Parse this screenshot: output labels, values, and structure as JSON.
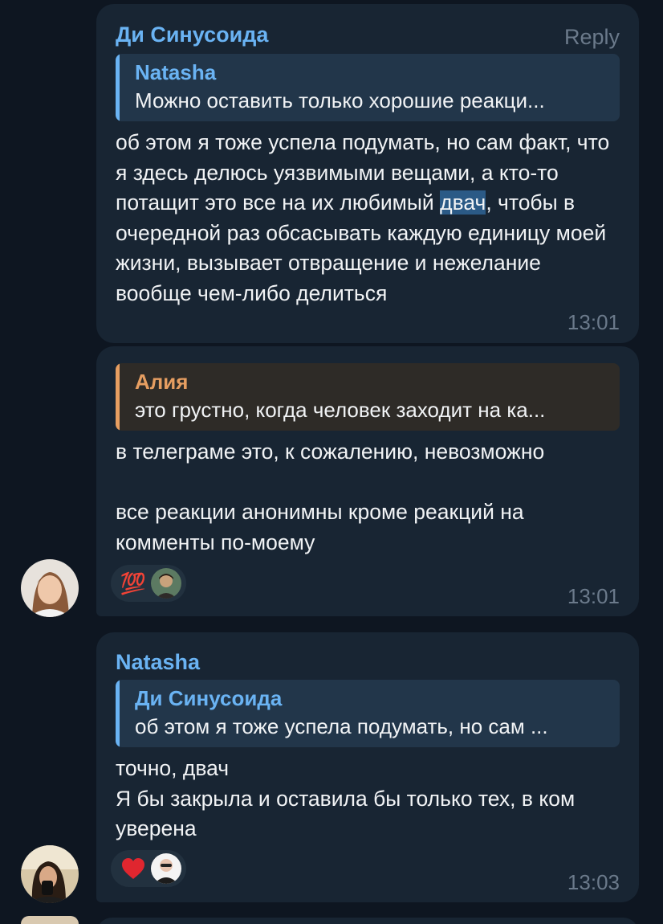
{
  "messages": [
    {
      "sender": "Ди Синусоида",
      "sender_color": "#6ab3f3",
      "reply_label": "Reply",
      "quote": {
        "name": "Natasha",
        "text": "Можно оставить только хорошие реакци...",
        "accent": "#6ab3f3"
      },
      "text_before": "об этом я тоже успела подумать, но сам факт, что я здесь делюсь уязвимыми вещами, а кто-то потащит это все на их любимый ",
      "text_highlight": "двач",
      "text_after": ", чтобы в очередной раз обсасывать каждую единицу моей жизни, вызывает отвращение и нежелание вообще чем-либо делиться",
      "time": "13:01"
    },
    {
      "quote": {
        "name": "Алия",
        "text": "это грустно, когда человек заходит на ка...",
        "accent": "#e69e61"
      },
      "paragraph_1": "в телеграме это, к сожалению, невозможно",
      "paragraph_2": "все реакции анонимны кроме реакций на комменты по-моему",
      "reaction": {
        "emoji": "💯",
        "icon": "hundred-points-icon"
      },
      "time": "13:01"
    },
    {
      "sender": "Natasha",
      "sender_color": "#6ab3f3",
      "quote": {
        "name": "Ди Синусоида",
        "text": "об этом я тоже успела подумать, но сам ...",
        "accent": "#6ab3f3"
      },
      "line_1": "точно, двач",
      "line_2": "Я бы закрыла и оставила бы только тех, в ком уверена",
      "reaction": {
        "emoji": "❤️",
        "icon": "red-heart-icon"
      },
      "time": "13:03"
    }
  ],
  "colors": {
    "background": "#0e1621",
    "bubble": "#182533",
    "link_blue": "#6ab3f3",
    "quote_orange": "#e69e61",
    "meta_gray": "#6b7a8b"
  }
}
